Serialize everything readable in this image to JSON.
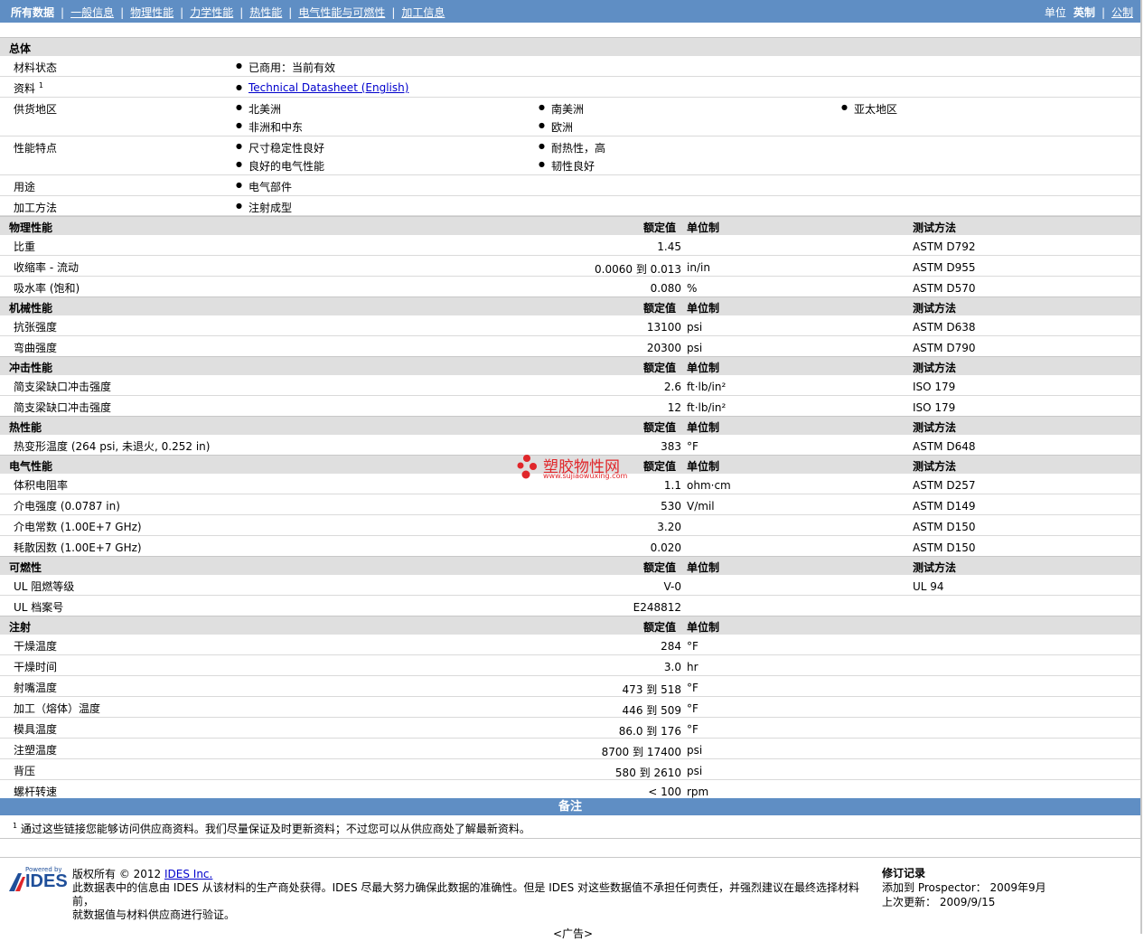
{
  "nav": {
    "items": [
      "所有数据",
      "一般信息",
      "物理性能",
      "力学性能",
      "热性能",
      "电气性能与可燃性",
      "加工信息"
    ],
    "units_label": "单位",
    "unit_selected": "英制",
    "unit_other": "公制"
  },
  "general": {
    "title": "总体",
    "status_label": "材料状态",
    "status_value": "已商用：当前有效",
    "source_label": "资料",
    "source_sup": "1",
    "source_link": "Technical Datasheet (English)",
    "supply_label": "供货地区",
    "supply": [
      "北美洲",
      "南美洲",
      "亚太地区",
      "非洲和中东",
      "欧洲"
    ],
    "features_label": "性能特点",
    "features": [
      "尺寸稳定性良好",
      "耐热性，高",
      "良好的电气性能",
      "韧性良好"
    ],
    "uses_label": "用途",
    "uses": [
      "电气部件"
    ],
    "process_label": "加工方法",
    "process": [
      "注射成型"
    ]
  },
  "headers": {
    "value": "额定值",
    "unit": "单位制",
    "method": "测试方法"
  },
  "physical": {
    "title": "物理性能",
    "rows": [
      {
        "label": "比重",
        "value": "1.45",
        "unit": "",
        "method": "ASTM D792"
      },
      {
        "label": "收缩率  - 流动",
        "value": "0.0060 到  0.013",
        "unit": "in/in",
        "method": "ASTM D955"
      },
      {
        "label": "吸水率  (饱和)",
        "value": "0.080",
        "unit": "%",
        "method": "ASTM D570"
      }
    ]
  },
  "mechanical": {
    "title": "机械性能",
    "rows": [
      {
        "label": "抗张强度",
        "value": "13100",
        "unit": "psi",
        "method": "ASTM D638"
      },
      {
        "label": "弯曲强度",
        "value": "20300",
        "unit": "psi",
        "method": "ASTM D790"
      }
    ]
  },
  "impact": {
    "title": "冲击性能",
    "rows": [
      {
        "label": "简支梁缺口冲击强度",
        "value": "2.6",
        "unit": "ft·lb/in²",
        "method": "ISO 179"
      },
      {
        "label": "简支梁缺口冲击强度",
        "value": "12",
        "unit": "ft·lb/in²",
        "method": "ISO 179"
      }
    ]
  },
  "thermal": {
    "title": "热性能",
    "rows": [
      {
        "label": "热变形温度  (264 psi, 未退火, 0.252 in)",
        "value": "383",
        "unit": "°F",
        "method": "ASTM D648"
      }
    ]
  },
  "electrical": {
    "title": "电气性能",
    "rows": [
      {
        "label": "体积电阻率",
        "value": "1.1",
        "unit": "ohm·cm",
        "method": "ASTM D257"
      },
      {
        "label": "介电强度  (0.0787 in)",
        "value": "530",
        "unit": "V/mil",
        "method": "ASTM D149"
      },
      {
        "label": "介电常数  (1.00E+7 GHz)",
        "value": "3.20",
        "unit": "",
        "method": "ASTM D150"
      },
      {
        "label": "耗散因数  (1.00E+7 GHz)",
        "value": "0.020",
        "unit": "",
        "method": "ASTM D150"
      }
    ]
  },
  "flammability": {
    "title": "可燃性",
    "rows": [
      {
        "label": "UL 阻燃等级",
        "value": "V-0",
        "unit": "",
        "method": "UL 94"
      },
      {
        "label": "UL 档案号",
        "value": "E248812",
        "unit": "",
        "method": ""
      }
    ]
  },
  "injection": {
    "title": "注射",
    "rows": [
      {
        "label": "干燥温度",
        "value": "284",
        "unit": "°F"
      },
      {
        "label": "干燥时间",
        "value": "3.0",
        "unit": "hr"
      },
      {
        "label": "射嘴温度",
        "value": "473 到  518",
        "unit": "°F"
      },
      {
        "label": "加工（熔体）温度",
        "value": "446 到  509",
        "unit": "°F"
      },
      {
        "label": "模具温度",
        "value": "86.0 到  176",
        "unit": "°F"
      },
      {
        "label": "注塑温度",
        "value": "8700 到  17400",
        "unit": "psi"
      },
      {
        "label": "背压",
        "value": "580 到  2610",
        "unit": "psi"
      },
      {
        "label": "螺杆转速",
        "value": "< 100",
        "unit": "rpm"
      }
    ]
  },
  "notes": {
    "title": "备注",
    "footnote_sup": "1",
    "footnote": "通过这些链接您能够访问供应商资料。我们尽量保证及时更新资料；不过您可以从供应商处了解最新资料。"
  },
  "footer": {
    "logo_small": "Powered by",
    "logo": "IDES",
    "copyright_prefix": "版权所有  © 2012 ",
    "company_link": "IDES Inc.",
    "disclaimer1": "此数据表中的信息由  IDES 从该材料的生产商处获得。IDES 尽最大努力确保此数据的准确性。但是  IDES 对这些数据值不承担任何责任，并强烈建议在最终选择材料前，",
    "disclaimer2": "就数据值与材料供应商进行验证。",
    "rev_title": "修订记录",
    "rev_added": "添加到  Prospector：  2009年9月",
    "rev_updated": "上次更新：   2009/9/15",
    "ad": "<广告>"
  },
  "watermark": {
    "cn": "塑胶物性网",
    "en": "www.sujiaowuxing.com"
  }
}
